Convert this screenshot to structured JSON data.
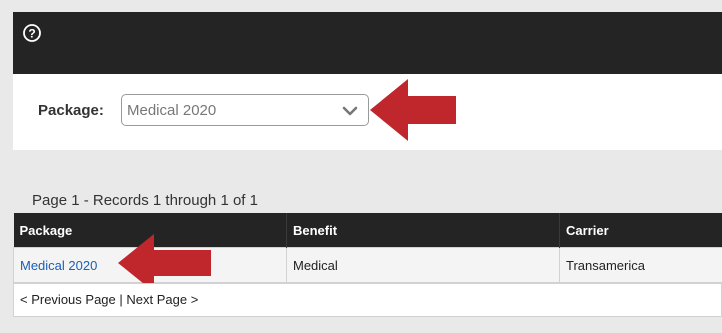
{
  "package_filter": {
    "label": "Package:",
    "selected_value": "Medical 2020"
  },
  "records_summary": "Page 1 - Records 1 through 1 of 1",
  "table": {
    "columns": [
      "Package",
      "Benefit",
      "Carrier"
    ],
    "rows": [
      {
        "package": "Medical 2020",
        "benefit": "Medical",
        "carrier": "Transamerica"
      }
    ]
  },
  "pager": {
    "previous_label": "< Previous Page",
    "separator": "|",
    "next_label": "Next Page >"
  },
  "colors": {
    "header_bg": "#242424",
    "link": "#1b5fb5",
    "annotation_arrow": "#c0272d"
  }
}
